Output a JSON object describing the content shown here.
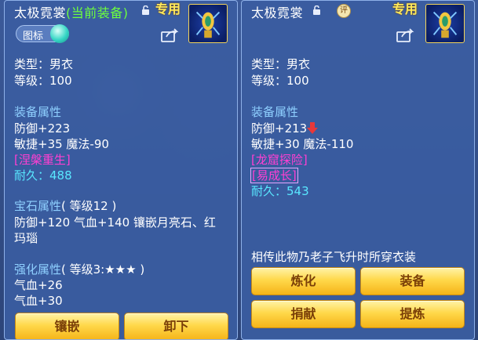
{
  "left_panel": {
    "name": "太极霓裳",
    "equipped_label": "(当前装备)",
    "exclusive": "专用",
    "tag_label": "图标",
    "type_line": "类型：男衣",
    "level_line": "等级：100",
    "attr_header": "装备属性",
    "defense": "防御+223",
    "agility_magic": "敏捷+35 魔法-90",
    "special_effect": "[涅槃重生]",
    "durability": "耐久：488",
    "gem_header": "宝石属性",
    "gem_level": "( 等级12 )",
    "gem_line1": "防御+120 气血+140 镶嵌月亮石、红",
    "gem_line2": "玛瑙",
    "enhance_header": "强化属性",
    "enhance_level": "( 等级3:★★★ )",
    "enhance_line1": "气血+26",
    "enhance_line2": "气血+30",
    "buttons": {
      "inlay": "镶嵌",
      "unequip": "卸下"
    }
  },
  "right_panel": {
    "name": "太极霓裳",
    "appraise_icon_text": "评",
    "exclusive": "专用",
    "type_line": "类型：男衣",
    "level_line": "等级：100",
    "attr_header": "装备属性",
    "defense": "防御+213",
    "agility_magic": "敏捷+30 魔法-110",
    "special_effect": "[龙窟探险]",
    "growth": "[易成长]",
    "durability": "耐久：543",
    "description": "相传此物乃老子飞升时所穿衣装",
    "buttons": {
      "refine": "炼化",
      "equip": "装备",
      "donate": "捐献",
      "extract": "提炼"
    }
  },
  "colors": {
    "panel": "#3a5ca0",
    "section": "#8fd0ff",
    "equipped": "#6dff3e",
    "special": "#ff3fd2",
    "durability": "#59e8ff",
    "button": "#ffd84a",
    "down_arrow": "#e8383a"
  },
  "icons": [
    "lock-icon",
    "share-icon",
    "equipment-icon",
    "appraise-icon",
    "down-arrow-icon",
    "tag-orb-icon"
  ]
}
